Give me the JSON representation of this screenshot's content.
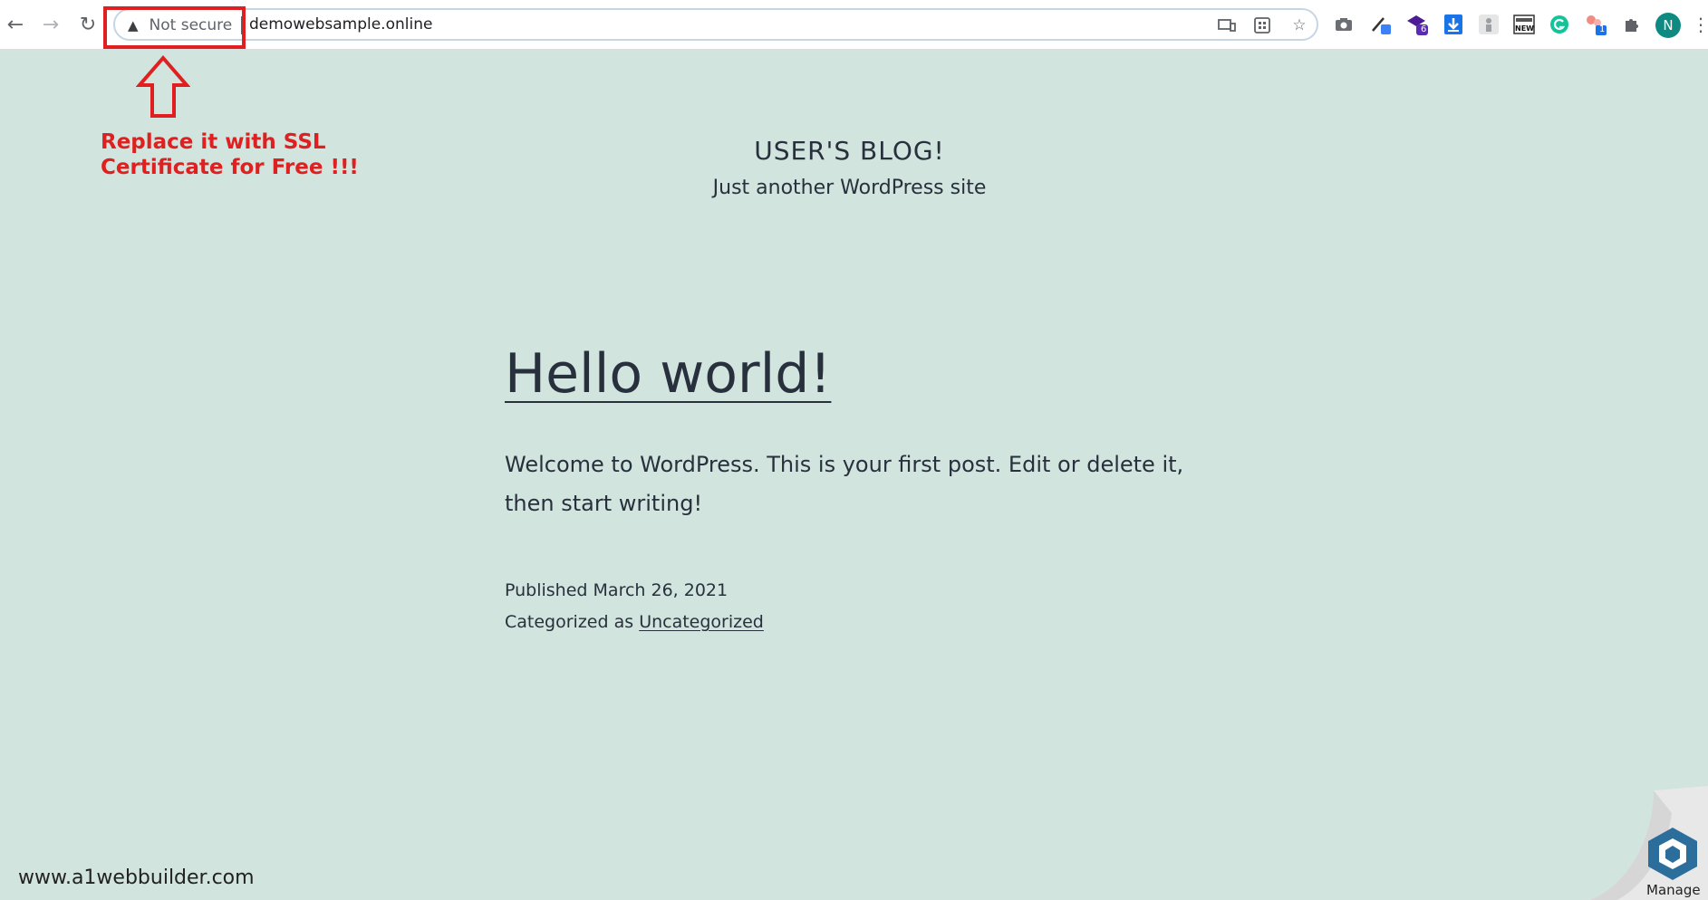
{
  "browser": {
    "security_label": "Not secure",
    "url": "demowebsample.online",
    "profile_initial": "N",
    "badge_one": "6",
    "badge_two": "1",
    "new_badge": "NEW"
  },
  "annotation": {
    "line1": "Replace it with SSL",
    "line2": "Certificate for Free !!!",
    "color": "#e02020"
  },
  "site": {
    "title": "USER'S BLOG!",
    "description": "Just another WordPress site",
    "background": "#d1e4dd"
  },
  "post": {
    "title": "Hello world!",
    "body": "Welcome to WordPress. This is your first post. Edit or delete it, then start writing!",
    "published_prefix": "Published",
    "published_date": "March 26, 2021",
    "category_prefix": "Categorized as",
    "category": "Uncategorized"
  },
  "footer": {
    "watermark": "www.a1webbuilder.com",
    "manage_label": "Manage"
  }
}
